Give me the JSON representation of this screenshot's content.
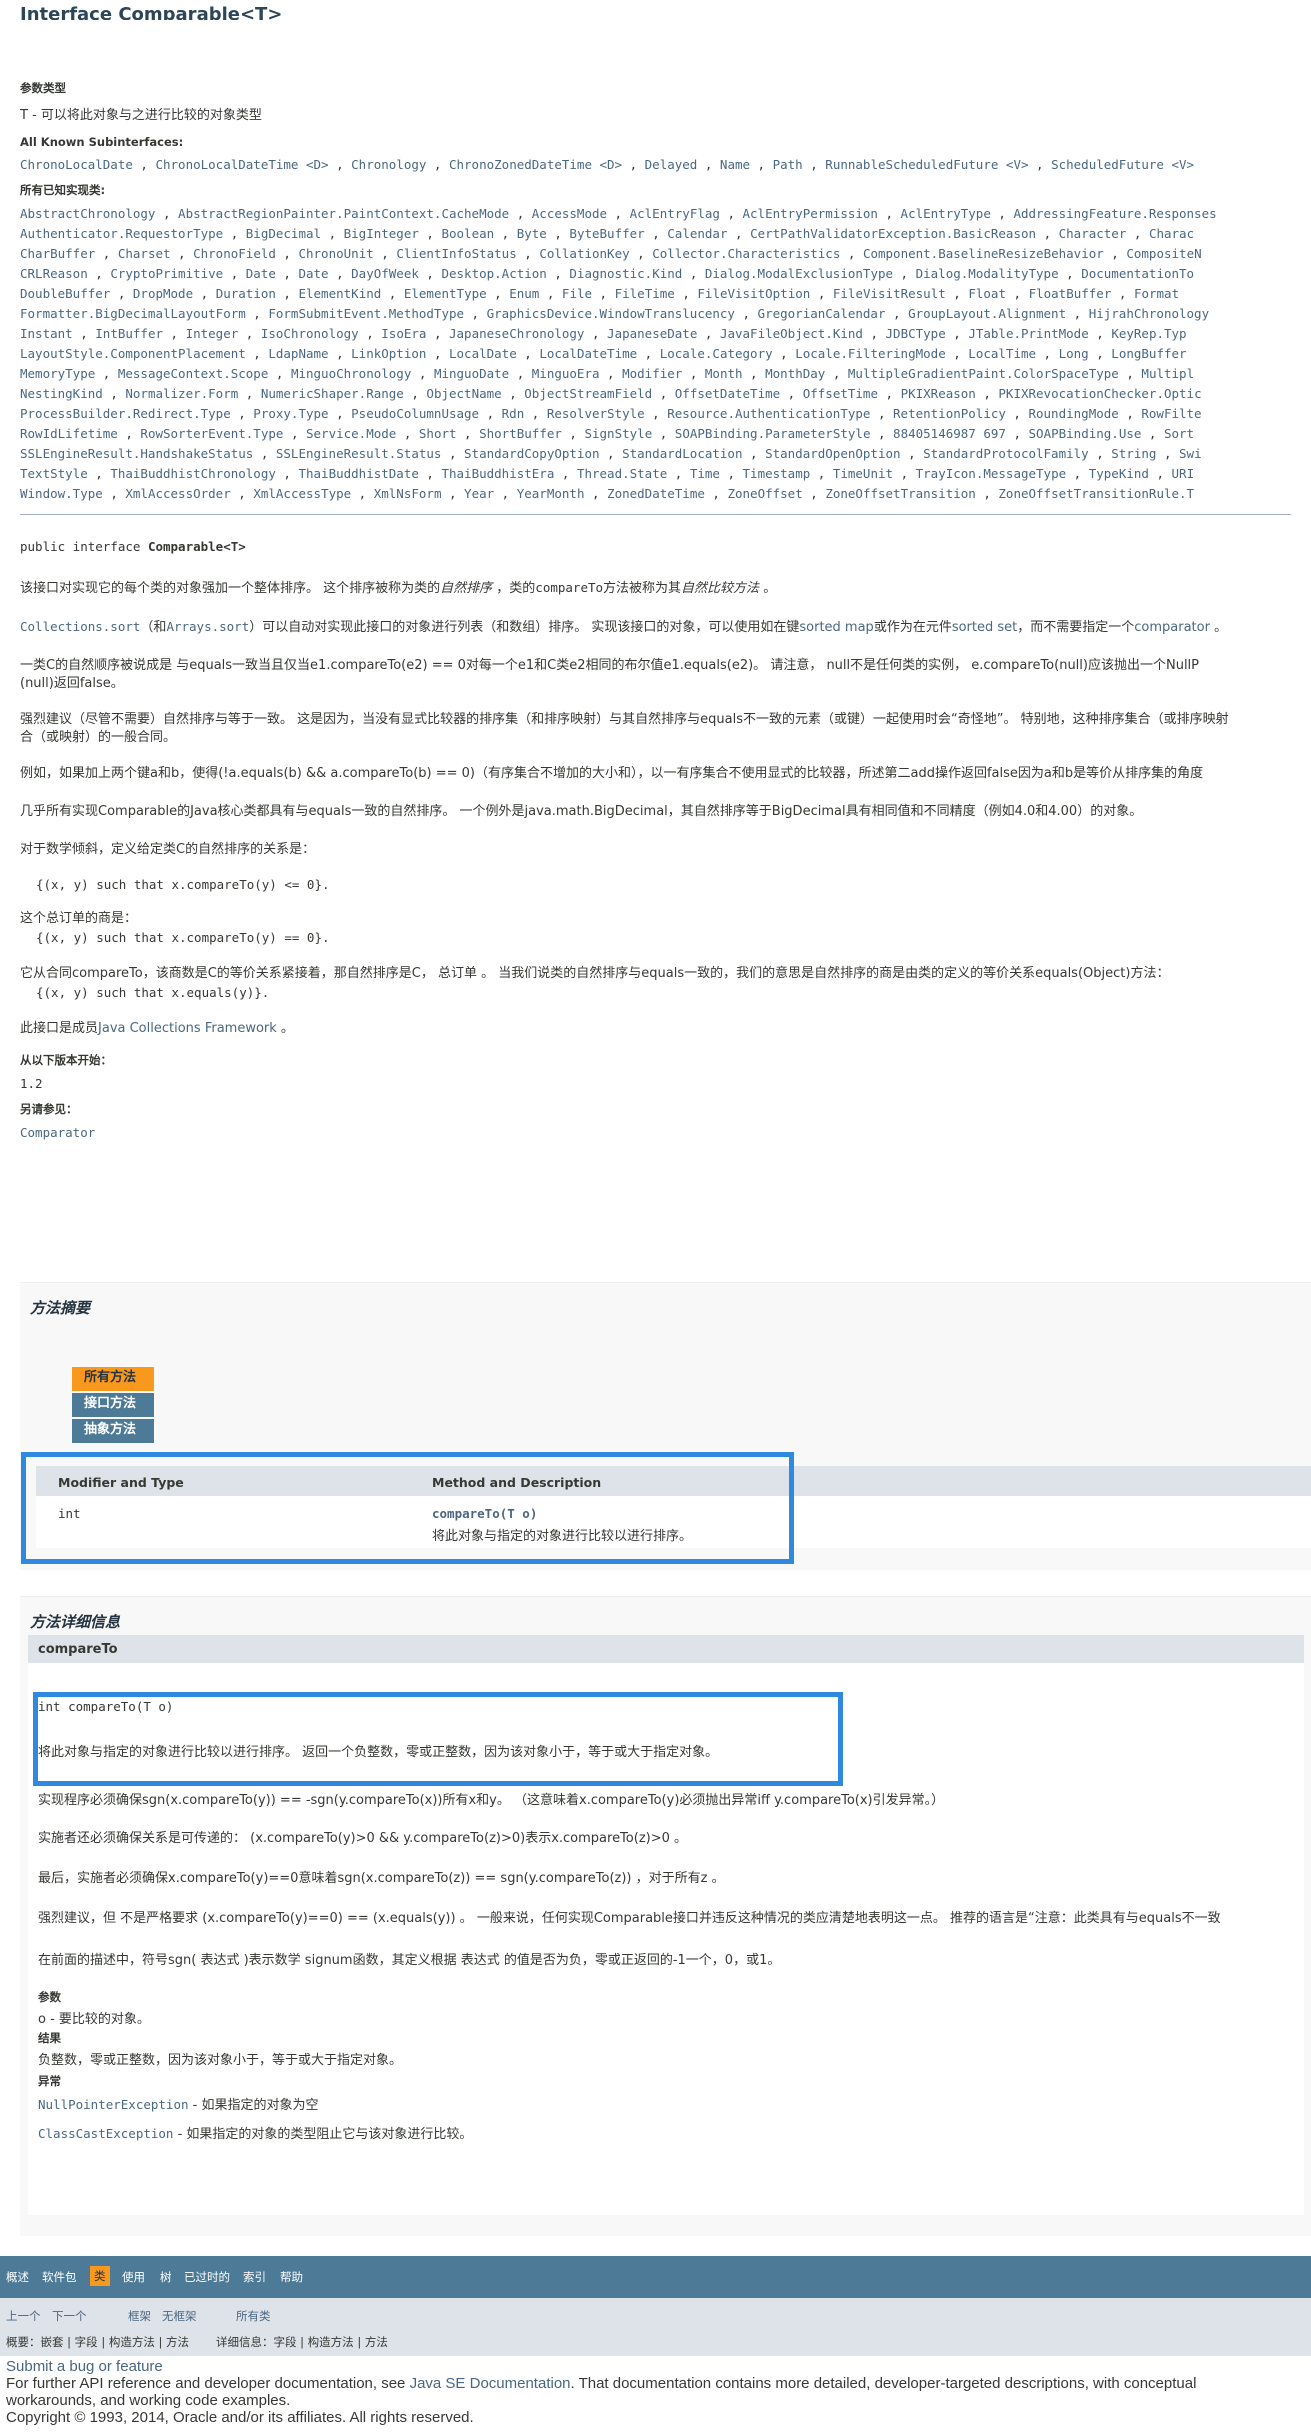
{
  "header": {
    "title": "Interface Comparable<T>"
  },
  "type_params": {
    "label": "参数类型",
    "text": "T - 可以将此对象与之进行比较的对象类型"
  },
  "subinterfaces": {
    "label": "All Known Subinterfaces:",
    "items": [
      "ChronoLocalDate",
      "ChronoLocalDateTime <D>",
      "Chronology",
      "ChronoZonedDateTime <D>",
      "Delayed",
      "Name",
      "Path",
      "RunnableScheduledFuture <V>",
      "ScheduledFuture <V>"
    ]
  },
  "implementing": {
    "label": "所有已知实现类:",
    "rows": [
      [
        "AbstractChronology",
        "AbstractRegionPainter.PaintContext.CacheMode",
        "AccessMode",
        "AclEntryFlag",
        "AclEntryPermission",
        "AclEntryType",
        "AddressingFeature.Responses"
      ],
      [
        "Authenticator.RequestorType",
        "BigDecimal",
        "BigInteger",
        "Boolean",
        "Byte",
        "ByteBuffer",
        "Calendar",
        "CertPathValidatorException.BasicReason",
        "Character",
        "Charac"
      ],
      [
        "CharBuffer",
        "Charset",
        "ChronoField",
        "ChronoUnit",
        "ClientInfoStatus",
        "CollationKey",
        "Collector.Characteristics",
        "Component.BaselineResizeBehavior",
        "CompositeN"
      ],
      [
        "CRLReason",
        "CryptoPrimitive",
        "Date",
        "Date",
        "DayOfWeek",
        "Desktop.Action",
        "Diagnostic.Kind",
        "Dialog.ModalExclusionType",
        "Dialog.ModalityType",
        "DocumentationTo"
      ],
      [
        "DoubleBuffer",
        "DropMode",
        "Duration",
        "ElementKind",
        "ElementType",
        "Enum",
        "File",
        "FileTime",
        "FileVisitOption",
        "FileVisitResult",
        "Float",
        "FloatBuffer",
        "Format"
      ],
      [
        "Formatter.BigDecimalLayoutForm",
        "FormSubmitEvent.MethodType",
        "GraphicsDevice.WindowTranslucency",
        "GregorianCalendar",
        "GroupLayout.Alignment",
        "HijrahChronology"
      ],
      [
        "Instant",
        "IntBuffer",
        "Integer",
        "IsoChronology",
        "IsoEra",
        "JapaneseChronology",
        "JapaneseDate",
        "JavaFileObject.Kind",
        "JDBCType",
        "JTable.PrintMode",
        "KeyRep.Typ"
      ],
      [
        "LayoutStyle.ComponentPlacement",
        "LdapName",
        "LinkOption",
        "LocalDate",
        "LocalDateTime",
        "Locale.Category",
        "Locale.FilteringMode",
        "LocalTime",
        "Long",
        "LongBuffer"
      ],
      [
        "MemoryType",
        "MessageContext.Scope",
        "MinguoChronology",
        "MinguoDate",
        "MinguoEra",
        "Modifier",
        "Month",
        "MonthDay",
        "MultipleGradientPaint.ColorSpaceType",
        "Multipl"
      ],
      [
        "NestingKind",
        "Normalizer.Form",
        "NumericShaper.Range",
        "ObjectName",
        "ObjectStreamField",
        "OffsetDateTime",
        "OffsetTime",
        "PKIXReason",
        "PKIXRevocationChecker.Optic"
      ],
      [
        "ProcessBuilder.Redirect.Type",
        "Proxy.Type",
        "PseudoColumnUsage",
        "Rdn",
        "ResolverStyle",
        "Resource.AuthenticationType",
        "RetentionPolicy",
        "RoundingMode",
        "RowFilte"
      ],
      [
        "RowIdLifetime",
        "RowSorterEvent.Type",
        "Service.Mode",
        "Short",
        "ShortBuffer",
        "SignStyle",
        "SOAPBinding.ParameterStyle",
        "88405146987 697",
        "SOAPBinding.Use",
        "Sort"
      ],
      [
        "SSLEngineResult.HandshakeStatus",
        "SSLEngineResult.Status",
        "StandardCopyOption",
        "StandardLocation",
        "StandardOpenOption",
        "StandardProtocolFamily",
        "String",
        "Swi"
      ],
      [
        "TextStyle",
        "ThaiBuddhistChronology",
        "ThaiBuddhistDate",
        "ThaiBuddhistEra",
        "Thread.State",
        "Time",
        "Timestamp",
        "TimeUnit",
        "TrayIcon.MessageType",
        "TypeKind",
        "URI"
      ],
      [
        "Window.Type",
        "XmlAccessOrder",
        "XmlAccessType",
        "XmlNsForm",
        "Year",
        "YearMonth",
        "ZonedDateTime",
        "ZoneOffset",
        "ZoneOffsetTransition",
        "ZoneOffsetTransitionRule.T"
      ]
    ]
  },
  "declaration": {
    "prefix": "public interface ",
    "name": "Comparable<T>"
  },
  "description": {
    "p1_a": "该接口对实现它的每个类的对象强加一个整体排序。 这个排序被称为类的",
    "p1_b": "自然排序",
    "p1_c": " ，类的",
    "p1_d": "compareTo",
    "p1_e": "方法被称为其",
    "p1_f": "自然比较方法",
    "p1_g": " 。",
    "p2_a": "Collections.sort",
    "p2_b": "（和",
    "p2_c": "Arrays.sort",
    "p2_d": "）可以自动对实现此接口的对象进行列表（和数组）排序。 实现该接口的对象，可以使用如在键",
    "p2_e": "sorted map",
    "p2_f": "或作为在元件",
    "p2_g": "sorted set",
    "p2_h": "，而不需要指定一个",
    "p2_i": "comparator",
    "p2_j": " 。",
    "p3_line1": "一类C的自然顺序被说成是 与equals一致当且仅当e1.compareTo(e2) == 0对每一个e1和C类e2相同的布尔值e1.equals(e2)。 请注意， null不是任何类的实例， e.compareTo(null)应该抛出一个NullP",
    "p3_line2": "(null)返回false。",
    "p4_line1": "强烈建议（尽管不需要）自然排序与等于一致。 这是因为，当没有显式比较器的排序集（和排序映射）与其自然排序与equals不一致的元素（或键）一起使用时会“奇怪地”。 特别地，这种排序集合（或排序映射",
    "p4_line2": "合（或映射）的一般合同。",
    "p5": "例如，如果加上两个键a和b，使得(!a.equals(b) && a.compareTo(b) == 0)（有序集合不增加的大小和），以一有序集合不使用显式的比较器，所述第二add操作返回false因为a和b是等价从排序集的角度",
    "p6": "几乎所有实现Comparable的Java核心类都具有与equals一致的自然排序。 一个例外是java.math.BigDecimal，其自然排序等于BigDecimal具有相同值和不同精度（例如4.0和4.00）的对象。",
    "p7": "对于数学倾斜，定义给定类C的自然排序的关系是：",
    "code1": "{(x, y) such that x.compareTo(y) <= 0}.",
    "p8": "这个总订单的商是：",
    "code2": "{(x, y) such that x.compareTo(y) == 0}.",
    "p9": "它从合同compareTo，该商数是C的等价关系紧接着，那自然排序是C， 总订单 。 当我们说类的自然排序与equals一致的，我们的意思是自然排序的商是由类的定义的等价关系equals(Object)方法：",
    "code3": "{(x, y) such that x.equals(y)}.",
    "p10_a": "此接口是成员",
    "p10_b": "Java Collections Framework",
    "p10_c": " 。"
  },
  "since": {
    "label": "从以下版本开始：",
    "value": "1.2"
  },
  "see_also": {
    "label": "另请参见：",
    "link": "Comparator"
  },
  "summary": {
    "title": "方法摘要",
    "tabs": [
      "所有方法",
      "接口方法",
      "抽象方法"
    ],
    "col1": "Modifier and Type",
    "col2": "Method and Description",
    "row": {
      "type": "int",
      "method": "compareTo(T o)",
      "desc": "将此对象与指定的对象进行比较以进行排序。"
    }
  },
  "detail": {
    "title": "方法详细信息",
    "method_name": "compareTo",
    "signature": "int compareTo(T o)",
    "desc": "将此对象与指定的对象进行比较以进行排序。 返回一个负整数，零或正整数，因为该对象小于，等于或大于指定对象。",
    "d1": "实现程序必须确保sgn(x.compareTo(y)) == -sgn(y.compareTo(x))所有x和y。 （这意味着x.compareTo(y)必须抛出异常iff y.compareTo(x)引发异常。）",
    "d2": "实施者还必须确保关系是可传递的： (x.compareTo(y)>0 && y.compareTo(z)>0)表示x.compareTo(z)>0 。",
    "d3": "最后，实施者必须确保x.compareTo(y)==0意味着sgn(x.compareTo(z)) == sgn(y.compareTo(z)) ，对于所有z 。",
    "d4": "强烈建议，但 不是严格要求 (x.compareTo(y)==0) == (x.equals(y)) 。 一般来说，任何实现Comparable接口并违反这种情况的类应清楚地表明这一点。 推荐的语言是“注意：此类具有与equals不一致",
    "d5": "在前面的描述中，符号sgn( 表达式 )表示数学 signum函数，其定义根据 表达式 的值是否为负，零或正返回的-1一个，0，或1。",
    "params_label": "参数",
    "param": "o - 要比较的对象。",
    "result_label": "结果",
    "result": "负整数，零或正整数，因为该对象小于，等于或大于指定对象。",
    "throws_label": "异常",
    "ex1": "NullPointerException",
    "ex1_desc": " - 如果指定的对象为空",
    "ex2": "ClassCastException",
    "ex2_desc": " - 如果指定的对象的类型阻止它与该对象进行比较。"
  },
  "bottom_nav": {
    "items": [
      "概述",
      "软件包",
      "类",
      "使用",
      "树",
      "已过时的",
      "索引",
      "帮助"
    ],
    "prev": "上一个",
    "next": "下一个",
    "frames": "框架",
    "noframes": "无框架",
    "all_classes": "所有类",
    "summary_line": "概要：嵌套 | 字段 | 构造方法 | 方法",
    "detail_line": "详细信息：字段 | 构造方法 | 方法"
  },
  "footer": {
    "bug_link": "Submit a bug or feature",
    "line1_a": "For further API reference and developer documentation, see ",
    "line1_link": "Java SE Documentation",
    "line1_b": ". That documentation contains more detailed, developer-targeted descriptions, with conceptual",
    "line2": "workarounds, and working code examples.",
    "copyright": "Copyright © 1993, 2014, Oracle and/or its affiliates. All rights reserved."
  },
  "colors": {
    "link": "#4A6782",
    "nav_bg": "#4D7A97",
    "tab_active": "#F8981D",
    "highlight": "#2F89E0",
    "table_head": "#DEE3E9"
  }
}
